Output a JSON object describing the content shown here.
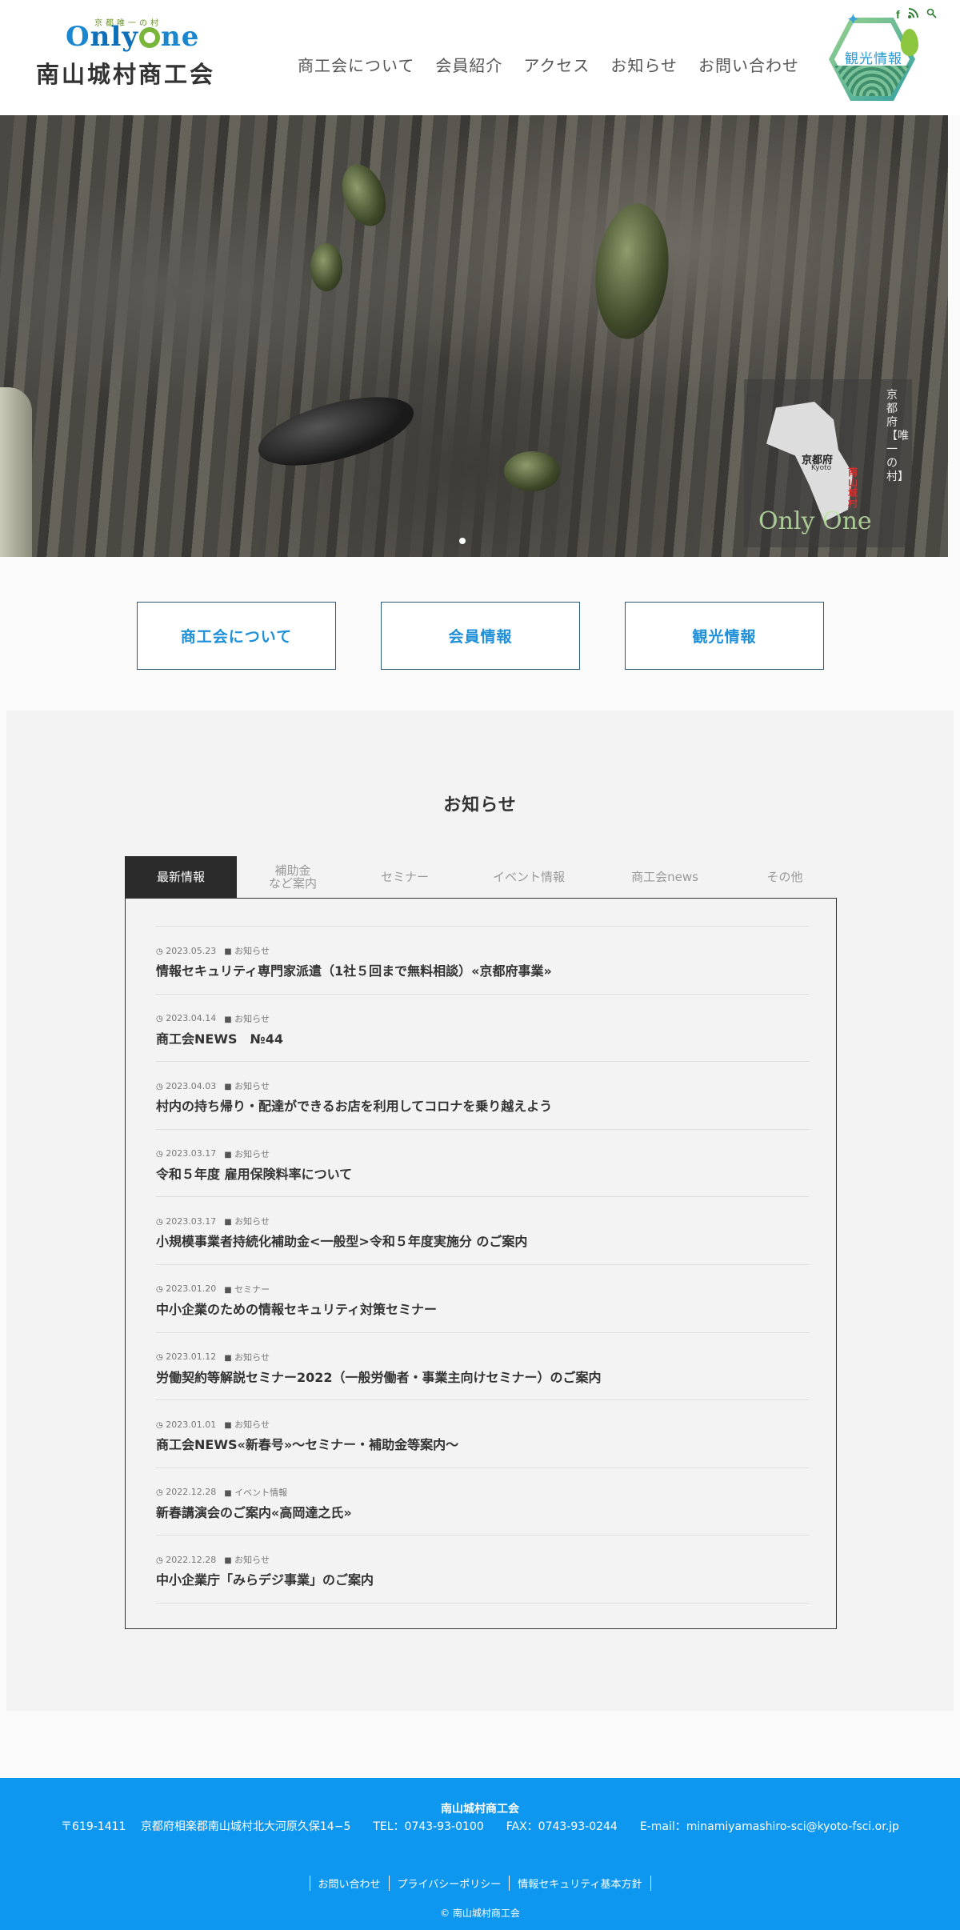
{
  "header": {
    "logo_tagline": "京都唯一の村",
    "logo_text": "OnlyOne",
    "logo_name": "南山城村商工会",
    "nav": [
      "商工会について",
      "会員紹介",
      "アクセス",
      "お知らせ",
      "お問い合わせ"
    ],
    "icons": [
      "facebook-icon",
      "rss-icon",
      "search-icon"
    ],
    "tourism_badge": "観光情報"
  },
  "hero": {
    "map_label": "京都府",
    "map_label_en": "Kyoto",
    "village_label": "南山城村",
    "vertical_text": "京都府【唯一の村】",
    "watermark": "Only One"
  },
  "cta": [
    "商工会について",
    "会員情報",
    "観光情報"
  ],
  "news": {
    "heading": "お知らせ",
    "tabs": [
      "最新情報",
      "補助金\nなど案内",
      "セミナー",
      "イベント情報",
      "商工会news",
      "その他"
    ],
    "active_tab": 0,
    "items": [
      {
        "date": "2023.05.23",
        "category": "お知らせ",
        "title": "情報セキュリティ専門家派遣（1社５回まで無料相談）«京都府事業»"
      },
      {
        "date": "2023.04.14",
        "category": "お知らせ",
        "title": "商工会NEWS　№44"
      },
      {
        "date": "2023.04.03",
        "category": "お知らせ",
        "title": "村内の持ち帰り・配達ができるお店を利用してコロナを乗り越えよう"
      },
      {
        "date": "2023.03.17",
        "category": "お知らせ",
        "title": "令和５年度 雇用保険料率について"
      },
      {
        "date": "2023.03.17",
        "category": "お知らせ",
        "title": "小規模事業者持続化補助金<一般型>令和５年度実施分 のご案内"
      },
      {
        "date": "2023.01.20",
        "category": "セミナー",
        "title": "中小企業のための情報セキュリティ対策セミナー"
      },
      {
        "date": "2023.01.12",
        "category": "お知らせ",
        "title": "労働契約等解説セミナー2022（一般労働者・事業主向けセミナー）のご案内"
      },
      {
        "date": "2023.01.01",
        "category": "お知らせ",
        "title": "商工会NEWS«新春号»〜セミナー・補助金等案内〜"
      },
      {
        "date": "2022.12.28",
        "category": "イベント情報",
        "title": "新春講演会のご案内«高岡達之氏»"
      },
      {
        "date": "2022.12.28",
        "category": "お知らせ",
        "title": "中小企業庁「みらデジ事業」のご案内"
      }
    ]
  },
  "footer": {
    "name": "南山城村商工会",
    "address": "〒619-1411　 京都府相楽郡南山城村北大河原久保14−5　　TEL：0743-93-0100　　FAX：0743-93-0244　　E-mail：minamiyamashiro-sci@kyoto-fsci.or.jp",
    "links": [
      "お問い合わせ",
      "プライバシーポリシー",
      "情報セキュリティ基本方針"
    ],
    "copyright": "© 南山城村商工会"
  },
  "colors": {
    "accent": "#1e90d8",
    "footer_bg": "#0e97ee",
    "active_tab": "#2b2b2b"
  }
}
